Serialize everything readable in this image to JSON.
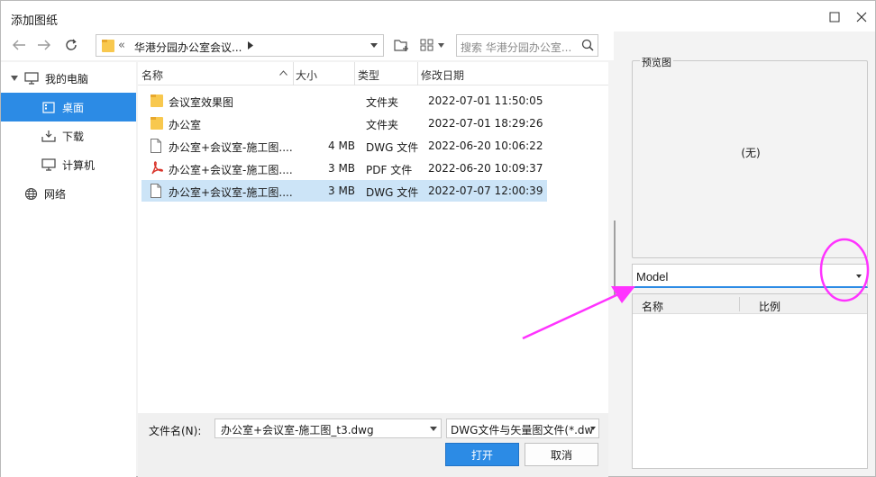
{
  "window": {
    "title": "添加图纸",
    "maximize_icon": "maximize-icon",
    "close_icon": "close-icon"
  },
  "nav": {
    "back_icon": "back-arrow-icon",
    "forward_icon": "forward-arrow-icon",
    "refresh_icon": "refresh-icon",
    "address_sep": "«",
    "address_text": "华港分园办公室会议...",
    "new_folder_icon": "new-folder-icon",
    "view_icon": "grid-view-icon",
    "search_placeholder": "搜索 华港分园办公室..."
  },
  "sidebar": {
    "items": [
      {
        "label": "我的电脑",
        "icon": "computer-icon"
      },
      {
        "label": "桌面",
        "icon": "desktop-icon"
      },
      {
        "label": "下载",
        "icon": "download-icon"
      },
      {
        "label": "计算机",
        "icon": "computer-icon"
      },
      {
        "label": "网络",
        "icon": "globe-icon"
      }
    ]
  },
  "file_list": {
    "columns": [
      "名称",
      "大小",
      "类型",
      "修改日期"
    ],
    "rows": [
      {
        "name": "会议室效果图",
        "size": "",
        "type": "文件夹",
        "date": "2022-07-01 11:50:05",
        "icon": "folder-icon"
      },
      {
        "name": "办公室",
        "size": "",
        "type": "文件夹",
        "date": "2022-07-01 18:29:26",
        "icon": "folder-icon"
      },
      {
        "name": "办公室+会议室-施工图....",
        "size": "4 MB",
        "type": "DWG 文件",
        "date": "2022-06-20 10:06:22",
        "icon": "file-icon"
      },
      {
        "name": "办公室+会议室-施工图....",
        "size": "3 MB",
        "type": "PDF 文件",
        "date": "2022-06-20 10:09:37",
        "icon": "pdf-icon"
      },
      {
        "name": "办公室+会议室-施工图....",
        "size": "3 MB",
        "type": "DWG 文件",
        "date": "2022-07-07 12:00:39",
        "icon": "file-icon"
      }
    ]
  },
  "bottom": {
    "filename_label": "文件名(N):",
    "filename_value": "办公室+会议室-施工图_t3.dwg",
    "filetype_value": "DWG文件与矢量图文件(*.dw",
    "open_label": "打开",
    "cancel_label": "取消"
  },
  "preview": {
    "legend": "预览图",
    "empty_text": "(无)"
  },
  "layout": {
    "selected": "Model",
    "columns": [
      "名称",
      "比例"
    ]
  },
  "colors": {
    "accent": "#2c8be5",
    "selection": "#cce4f7",
    "annotation": "#ff33ff"
  }
}
